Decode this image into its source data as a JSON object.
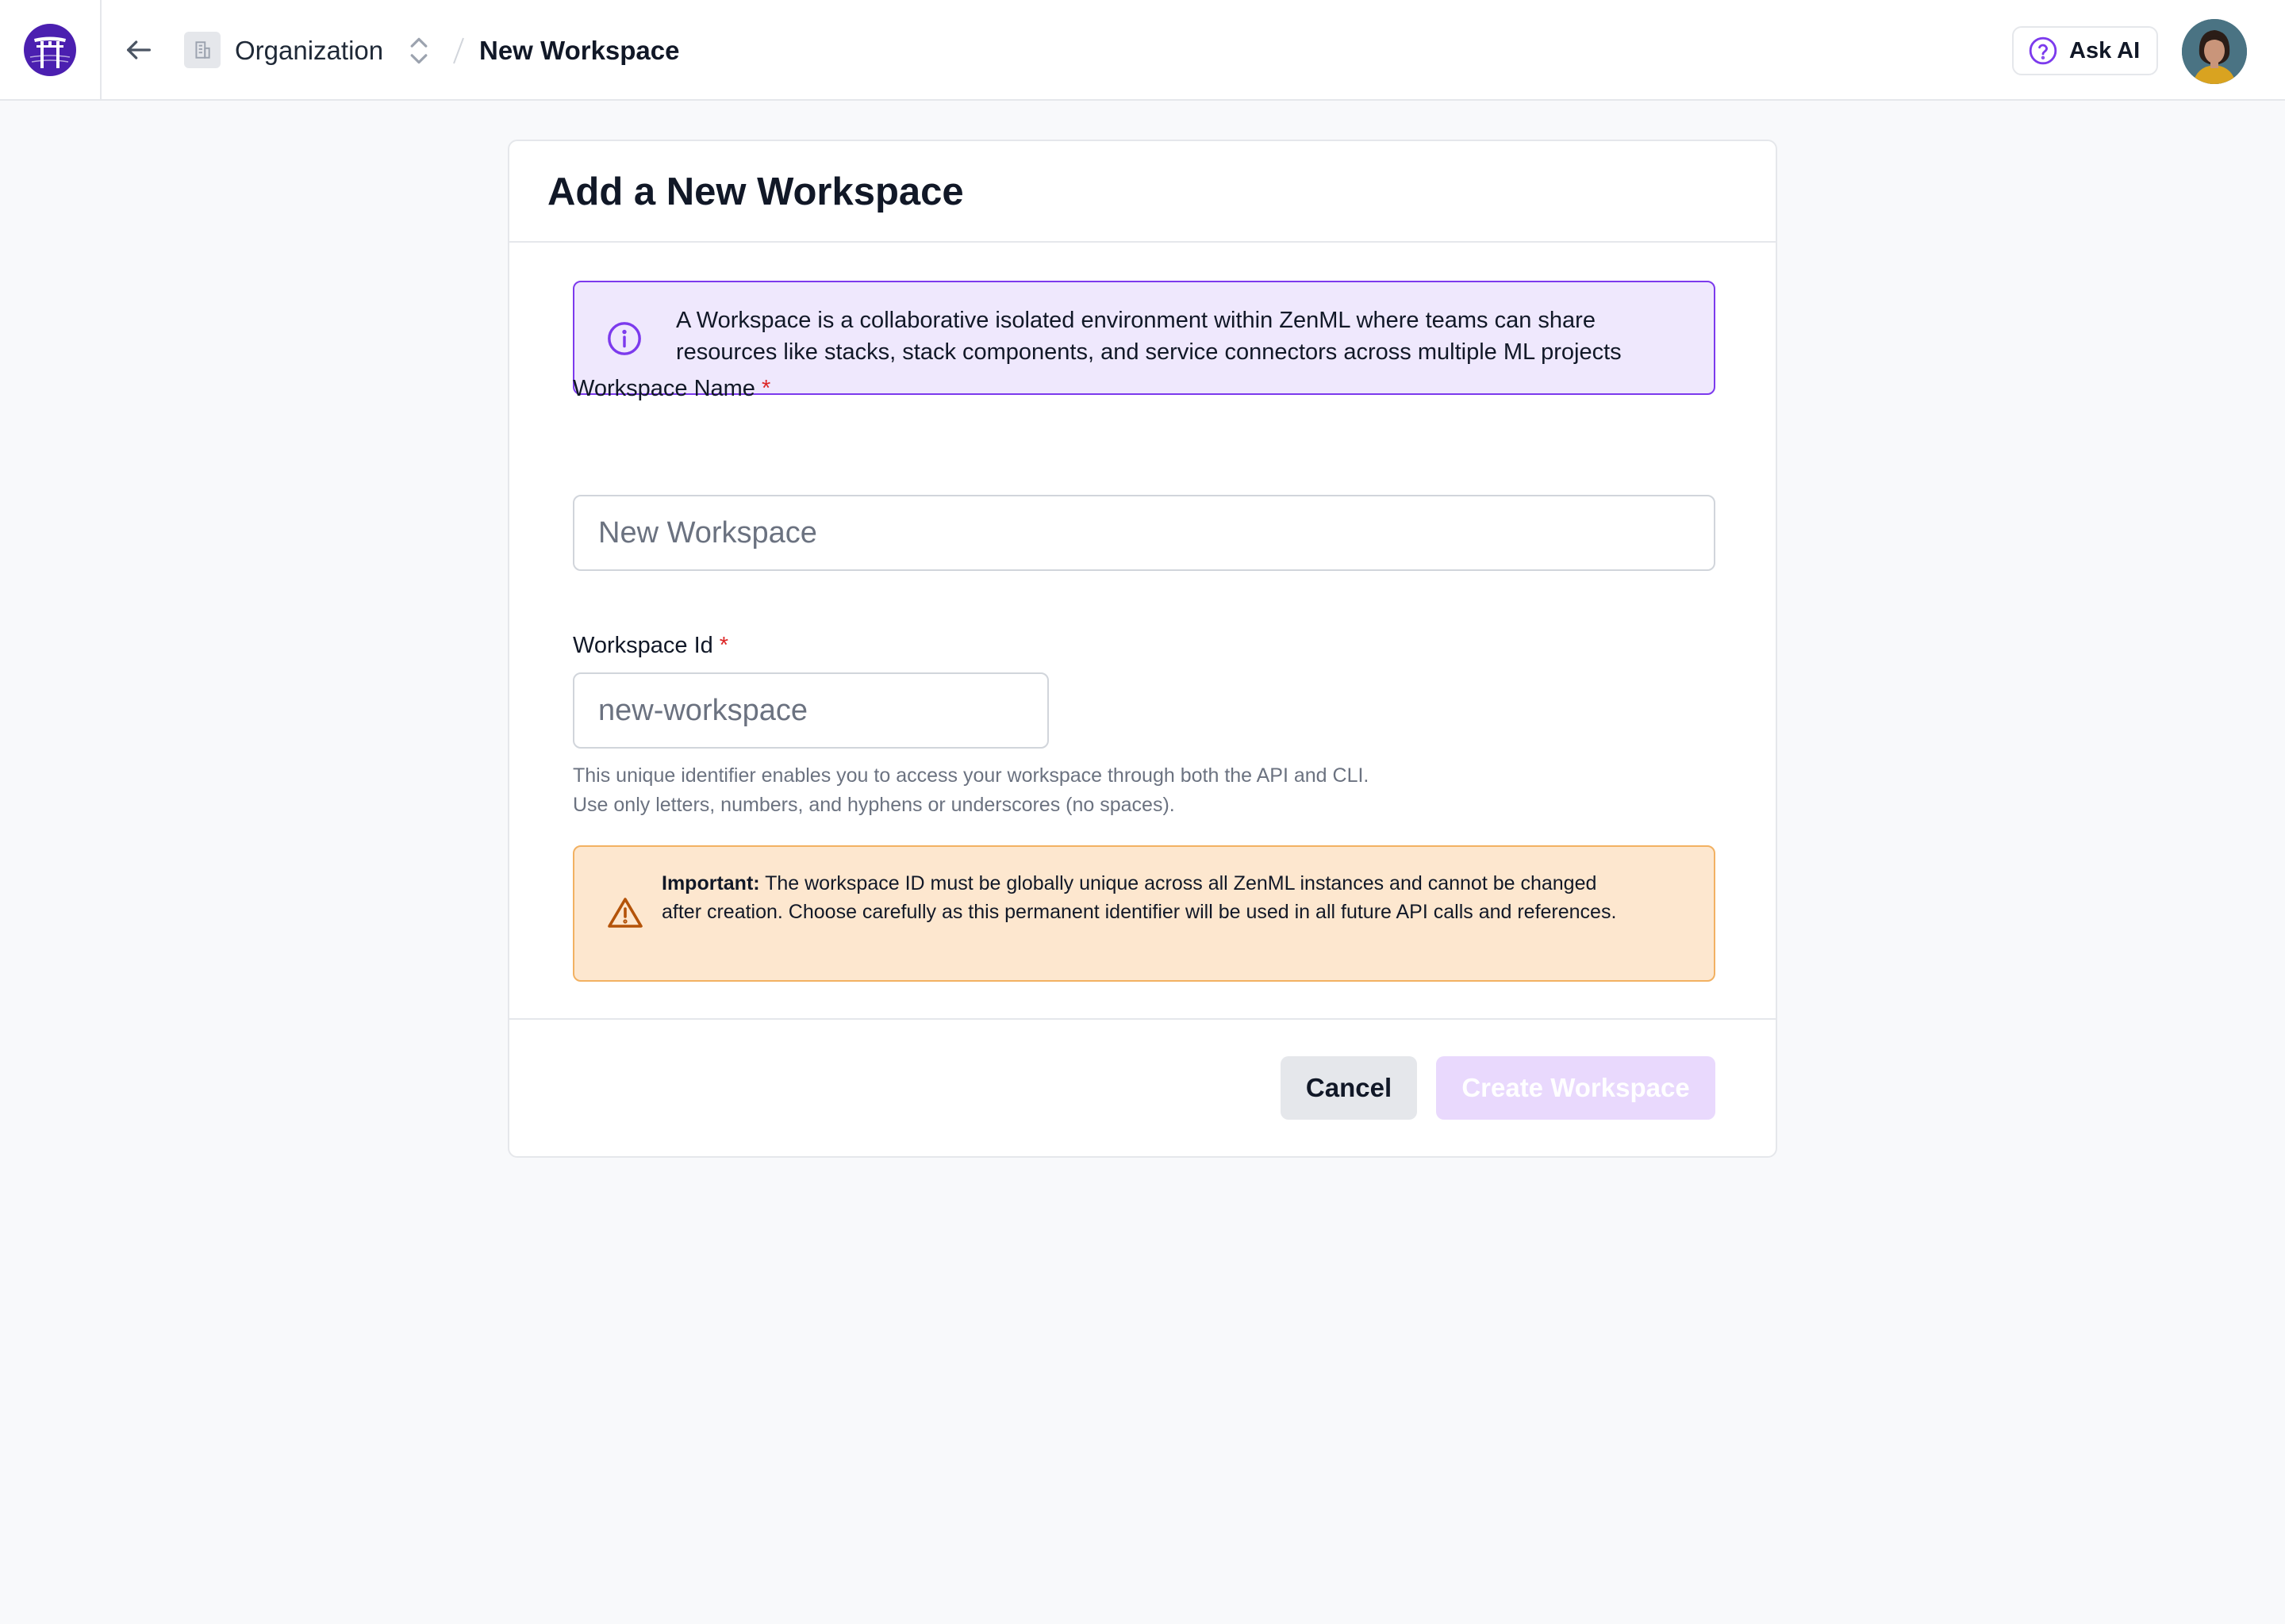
{
  "header": {
    "org_name": "Organization",
    "current_page": "New Workspace",
    "ask_ai_label": "Ask AI"
  },
  "card": {
    "title": "Add a New Workspace",
    "info_text": "A Workspace is a collaborative isolated environment within ZenML where teams can share resources like stacks, stack components, and service connectors across multiple ML projects",
    "name_field": {
      "label": "Workspace Name",
      "required_mark": "*",
      "value": "",
      "placeholder": "New Workspace"
    },
    "id_field": {
      "label": "Workspace Id",
      "required_mark": "*",
      "value": "",
      "placeholder": "new-workspace"
    },
    "help_line_1": "This unique identifier enables you to access your workspace through both the API and CLI.",
    "help_line_2": "Use only letters, numbers, and hyphens or underscores (no spaces).",
    "warning": {
      "strong": "Important:",
      "text": " The workspace ID must be globally unique across all ZenML instances and cannot be changed after creation. Choose carefully as this permanent identifier will be used in all future API calls and references."
    },
    "cancel_label": "Cancel",
    "create_label": "Create Workspace"
  },
  "colors": {
    "brand": "#4b1fb0",
    "accent": "#7c3aed",
    "info_bg": "#efe8fd",
    "warning_bg": "#fde7cf",
    "warning_border": "#f2b162",
    "warning_icon": "#b45309",
    "required": "#dc2626",
    "create_disabled_bg": "#e9d9fd"
  },
  "icons": {
    "logo": "zenml-torii-logo",
    "back": "arrow-left-icon",
    "org": "building-icon",
    "switch": "chevron-up-down-icon",
    "ask_ai": "question-circle-icon",
    "info": "info-circle-icon",
    "warning": "warning-triangle-icon"
  }
}
